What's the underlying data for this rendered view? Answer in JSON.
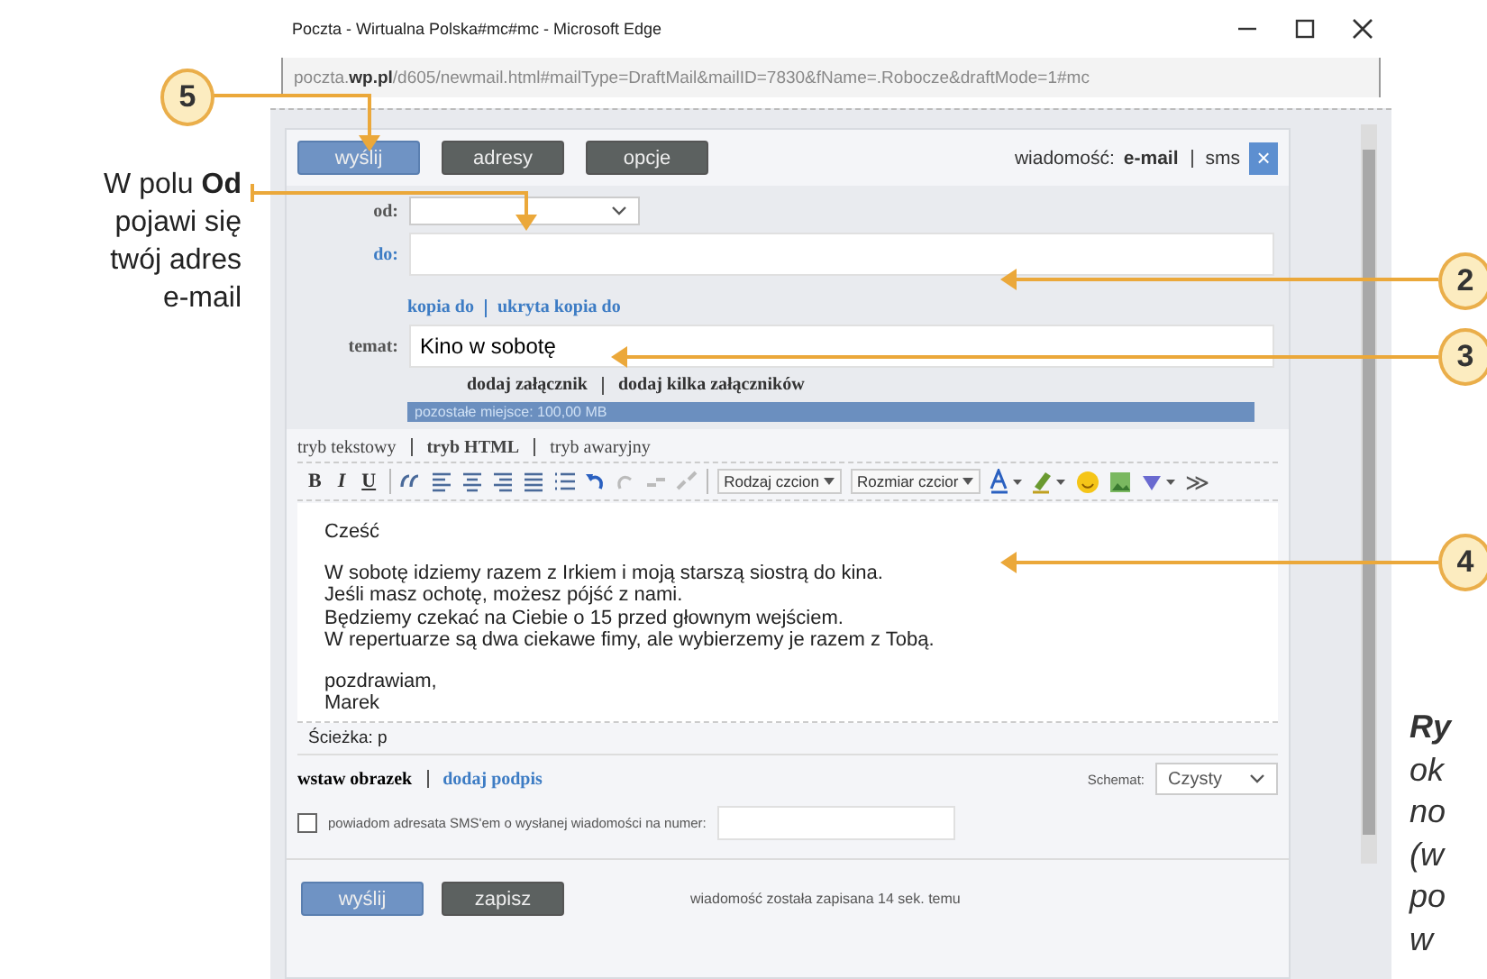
{
  "annotation": {
    "text": "W polu **Od** pojawi się twój adres e-mail"
  },
  "callouts": [
    {
      "number": "5"
    },
    {
      "number": "2"
    },
    {
      "number": "3"
    },
    {
      "number": "4"
    }
  ],
  "window": {
    "title": "Poczta - Wirtualna Polska#mc#mc - Microsoft Edge",
    "address": "poczta.**wp.pl**/d605/newmail.html#mailType=DraftMail&mailID=7830&fName=.Robocze&draftMode=1#mc"
  },
  "top_buttons": [
    {
      "label": "wyślij",
      "kind": "primary"
    },
    {
      "label": "adresy",
      "kind": "dark"
    },
    {
      "label": "opcje",
      "kind": "dark"
    }
  ],
  "message_type": {
    "label": "wiadomość:",
    "options": [
      {
        "label": "e-mail",
        "selected": true
      },
      {
        "label": "sms",
        "selected": false
      }
    ],
    "close": "×"
  },
  "form": {
    "from_label": "od:",
    "to_label": "do:",
    "copy_links": [
      "kopia do",
      "ukryta kopia do"
    ],
    "subject_label": "temat:",
    "subject": "Kino w sobotę",
    "attach_links": [
      "dodaj załącznik",
      "dodaj kilka załączników"
    ],
    "space": {
      "text": "pozostałe miejsce: 100,00 MB",
      "level": 1
    }
  },
  "editor_modes": [
    {
      "label": "tryb tekstowy",
      "selected": false
    },
    {
      "label": "tryb HTML",
      "selected": true
    },
    {
      "label": "tryb awaryjny",
      "selected": false
    }
  ],
  "toolbar": {
    "format": [
      {
        "label": "B",
        "kind": "bold"
      },
      {
        "label": "I",
        "kind": "italic"
      },
      {
        "label": "U",
        "kind": "underline"
      }
    ],
    "dropdowns": [
      "Rodzaj czcion",
      "Rozmiar czcior"
    ],
    "more": "≫"
  },
  "body": [
    "Cześć",
    "W sobotę idziemy razem z Irkiem i moją starszą siostrą do kina.\nJeśli masz ochotę, możesz pójść z nami.\nBędziemy czekać na Ciebie o 15 przed głownym wejściem.\nW repertuarze są dwa ciekawe fimy, ale wybierzemy je razem z Tobą.",
    "pozdrawiam,\nMarek"
  ],
  "path": "Ścieżka: p",
  "extras": {
    "links": [
      "wstaw obrazek",
      "dodaj podpis"
    ],
    "scheme_label": "Schemat:",
    "scheme": "Czysty"
  },
  "sms_notify": {
    "label": "powiadom adresata SMS'em o wysłanej wiadomości na numer:",
    "checked": false
  },
  "bottom_buttons": [
    {
      "label": "wyślij",
      "kind": "primary"
    },
    {
      "label": "zapisz",
      "kind": "dark"
    }
  ],
  "status": "wiadomość została zapisana 14 sek. temu",
  "caption": [
    "**Ry**",
    "ok",
    "no",
    "(w",
    "po",
    "w"
  ]
}
